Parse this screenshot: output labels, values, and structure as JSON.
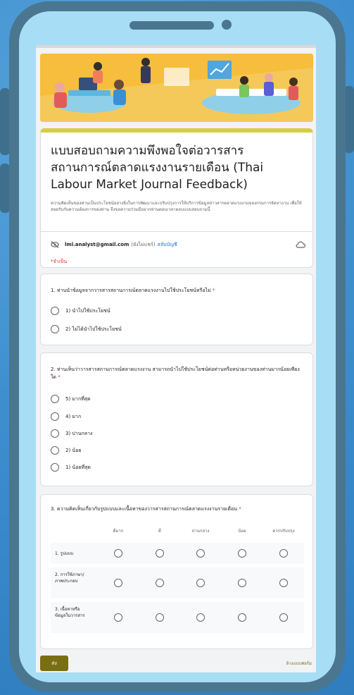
{
  "form": {
    "title": "แบบสอบถามความพึงพอใจต่อวารสารสถานการณ์ตลาดแรงงานรายเดือน (Thai Labour Market Journal Feedback)",
    "description": "ความคิดเห็นของท่านเป็นประโยชน์อย่างยิ่งในการพัฒนาและปรับปรุงการให้บริการข้อมูลข่าวสารตลาดแรงงานของกรมการจัดหางาน เพื่อให้สอดรับกับความต้องการของท่าน จึงขอความร่วมมือจากท่านตอบเวลาตอบแบบสอบถามนี้",
    "account_email": "lml.analyst@gmail.com",
    "account_status": "(ยังไม่แชร์)",
    "switch_account": "สลับบัญชี",
    "required_note": "*จำเป็น"
  },
  "questions": {
    "q1": {
      "title": "1. ท่านนำข้อมูลจากวารสารสถานการณ์ตลาดแรงงานไปใช้ประโยชน์หรือไม่",
      "required": "*",
      "options": [
        "1) นำไปใช้ประโยชน์",
        "2) ไม่ได้นำไปใช้ประโยชน์"
      ]
    },
    "q2": {
      "title": "2. ท่านเห็นว่าวารสารสถานการณ์ตลาดแรงงาน สามารถนำไปใช้ประโยชน์ต่อท่านหรือหน่วยงานของท่านมากน้อยเพียงใด",
      "required": "*",
      "options": [
        "5) มากที่สุด",
        "4) มาก",
        "3) ปานกลาง",
        "2) น้อย",
        "1) น้อยที่สุด"
      ]
    },
    "q3": {
      "title": "3. ความคิดเห็นเกี่ยวกับรูปแบบและเนื้อหาของวารสารสถานการณ์ตลาดแรงงานรายเดือน",
      "required": "*",
      "columns": [
        "ดีมาก",
        "ดี",
        "ปานกลาง",
        "น้อย",
        "ควรปรับปรุง"
      ],
      "rows": [
        "1. รูปแบบ",
        "2. การใช้ภาษา/ภาพประกอบ",
        "3. เนื้อหาหรือข้อมูลในวารสาร"
      ]
    }
  },
  "footer": {
    "submit_label": "ส่ง",
    "clear_label": "ล้างแบบฟอร์ม"
  },
  "colors": {
    "accent": "#7a6e12",
    "title_bar": "#d4ce45",
    "required": "#d93025",
    "link": "#1a73e8"
  }
}
